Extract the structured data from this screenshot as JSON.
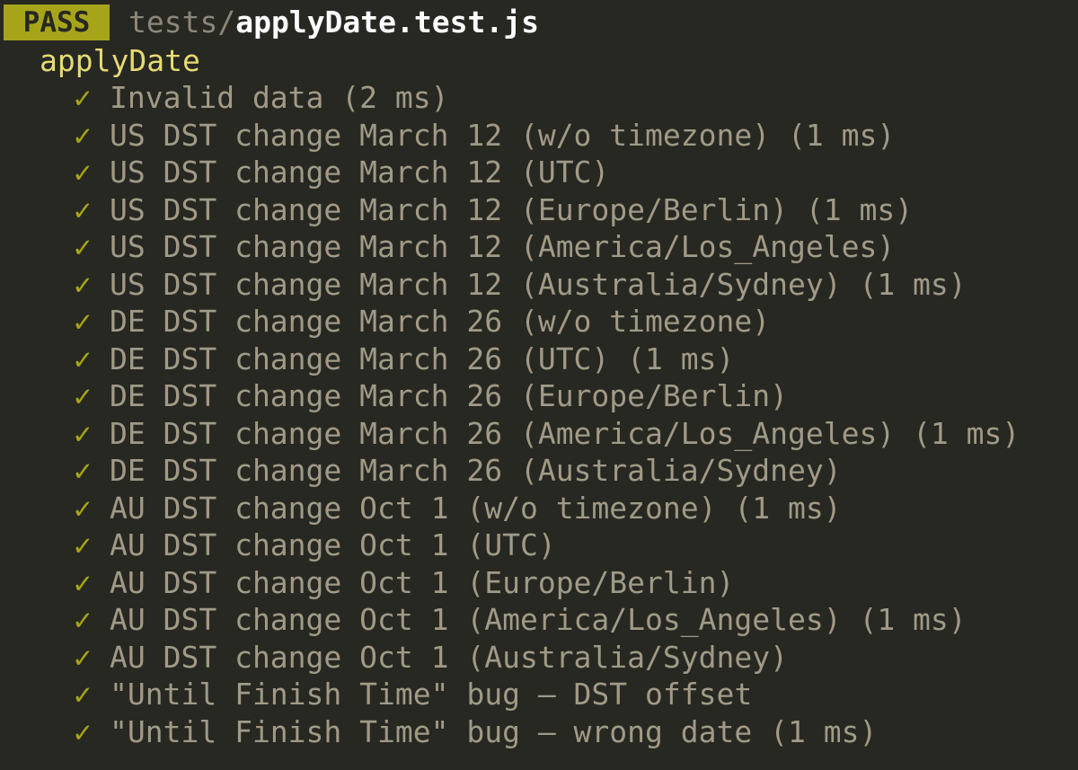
{
  "header": {
    "status": "PASS",
    "path_dir": "tests/",
    "path_file": "applyDate.test.js"
  },
  "suite": {
    "name": "applyDate"
  },
  "check_glyph": "✓",
  "tests": [
    {
      "name": "Invalid data",
      "time": "(2 ms)"
    },
    {
      "name": "US DST change March 12 (w/o timezone)",
      "time": "(1 ms)"
    },
    {
      "name": "US DST change March 12 (UTC)",
      "time": ""
    },
    {
      "name": "US DST change March 12 (Europe/Berlin)",
      "time": "(1 ms)"
    },
    {
      "name": "US DST change March 12 (America/Los_Angeles)",
      "time": ""
    },
    {
      "name": "US DST change March 12 (Australia/Sydney)",
      "time": "(1 ms)"
    },
    {
      "name": "DE DST change March 26 (w/o timezone)",
      "time": ""
    },
    {
      "name": "DE DST change March 26 (UTC)",
      "time": "(1 ms)"
    },
    {
      "name": "DE DST change March 26 (Europe/Berlin)",
      "time": ""
    },
    {
      "name": "DE DST change March 26 (America/Los_Angeles)",
      "time": "(1 ms)"
    },
    {
      "name": "DE DST change March 26 (Australia/Sydney)",
      "time": ""
    },
    {
      "name": "AU DST change Oct 1 (w/o timezone)",
      "time": "(1 ms)"
    },
    {
      "name": "AU DST change Oct 1 (UTC)",
      "time": ""
    },
    {
      "name": "AU DST change Oct 1 (Europe/Berlin)",
      "time": ""
    },
    {
      "name": "AU DST change Oct 1 (America/Los_Angeles)",
      "time": "(1 ms)"
    },
    {
      "name": "AU DST change Oct 1 (Australia/Sydney)",
      "time": ""
    },
    {
      "name": "\"Until Finish Time\" bug — DST offset",
      "time": ""
    },
    {
      "name": "\"Until Finish Time\" bug — wrong date",
      "time": "(1 ms)"
    }
  ],
  "colors": {
    "background": "#272822",
    "pass_badge": "#a6a51a",
    "check": "#a6a51a",
    "suite": "#e6db74",
    "text": "#a09a87",
    "file": "#ffffff"
  }
}
